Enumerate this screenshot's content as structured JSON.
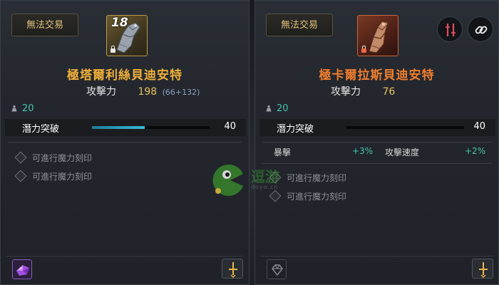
{
  "left_item": {
    "trade_status": "無法交易",
    "level": "18",
    "name": "極塔爾利絲貝迪安特",
    "attack_label": "攻擊力",
    "attack_value": "198",
    "attack_breakdown": "(66+132)",
    "weight": "20",
    "limit_break_label": "潛力突破",
    "limit_break_value": "40",
    "limit_break_progress": 0.45,
    "engravings": [
      "可進行魔力刻印",
      "可進行魔力刻印"
    ],
    "rarity_color": "#f0b03a"
  },
  "right_item": {
    "trade_status": "無法交易",
    "name": "極卡爾拉斯貝迪安特",
    "attack_label": "攻擊力",
    "attack_value": "76",
    "weight": "20",
    "limit_break_label": "潛力突破",
    "limit_break_value": "40",
    "limit_break_progress": 0.0,
    "sub_stats": [
      {
        "name": "暴擊",
        "value": "+3%"
      },
      {
        "name": "攻擊速度",
        "value": "+2%"
      }
    ],
    "engravings": [
      "可進行魔力刻印",
      "可進行魔力刻印"
    ],
    "rarity_color": "#f07e2e"
  },
  "icons": {
    "left_weapon": "gauntlet-icon",
    "right_weapon": "gauntlet-icon",
    "compare": "compare-swords-icon",
    "link": "chain-link-icon",
    "gem": "purple-gem-icon",
    "empty_gem": "empty-gem-slot-icon",
    "action": "sword-action-icon"
  },
  "watermark": {
    "text": "逗游",
    "sub": "doyo.cn"
  }
}
